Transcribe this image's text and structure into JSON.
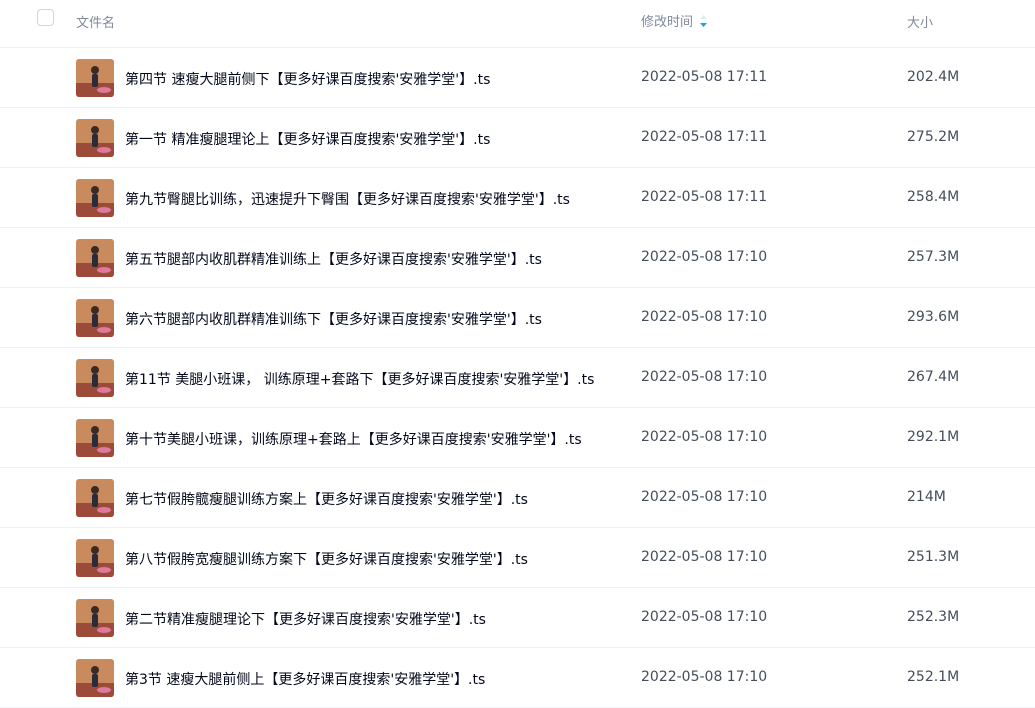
{
  "header": {
    "col_name": "文件名",
    "col_time": "修改时间",
    "col_size": "大小",
    "sort_icon": "sort-desc-icon",
    "accent_color": "#06a7ff"
  },
  "files": [
    {
      "name": "第四节 速瘦大腿前侧下【更多好课百度搜索'安雅学堂'】.ts",
      "modified": "2022-05-08 17:11",
      "size": "202.4M"
    },
    {
      "name": "第一节 精准瘦腿理论上【更多好课百度搜索'安雅学堂'】.ts",
      "modified": "2022-05-08 17:11",
      "size": "275.2M"
    },
    {
      "name": "第九节臀腿比训练，迅速提升下臀围【更多好课百度搜索'安雅学堂'】.ts",
      "modified": "2022-05-08 17:11",
      "size": "258.4M"
    },
    {
      "name": "第五节腿部内收肌群精准训练上【更多好课百度搜索'安雅学堂'】.ts",
      "modified": "2022-05-08 17:10",
      "size": "257.3M"
    },
    {
      "name": "第六节腿部内收肌群精准训练下【更多好课百度搜索'安雅学堂'】.ts",
      "modified": "2022-05-08 17:10",
      "size": "293.6M"
    },
    {
      "name": "第11节 美腿小班课， 训练原理+套路下【更多好课百度搜索'安雅学堂'】.ts",
      "modified": "2022-05-08 17:10",
      "size": "267.4M"
    },
    {
      "name": "第十节美腿小班课，训练原理+套路上【更多好课百度搜索'安雅学堂'】.ts",
      "modified": "2022-05-08 17:10",
      "size": "292.1M"
    },
    {
      "name": "第七节假胯髋瘦腿训练方案上【更多好课百度搜索'安雅学堂'】.ts",
      "modified": "2022-05-08 17:10",
      "size": "214M"
    },
    {
      "name": "第八节假胯宽瘦腿训练方案下【更多好课百度搜索'安雅学堂'】.ts",
      "modified": "2022-05-08 17:10",
      "size": "251.3M"
    },
    {
      "name": "第二节精准瘦腿理论下【更多好课百度搜索'安雅学堂'】.ts",
      "modified": "2022-05-08 17:10",
      "size": "252.3M"
    },
    {
      "name": "第3节 速瘦大腿前侧上【更多好课百度搜索'安雅学堂'】.ts",
      "modified": "2022-05-08 17:10",
      "size": "252.1M"
    }
  ]
}
